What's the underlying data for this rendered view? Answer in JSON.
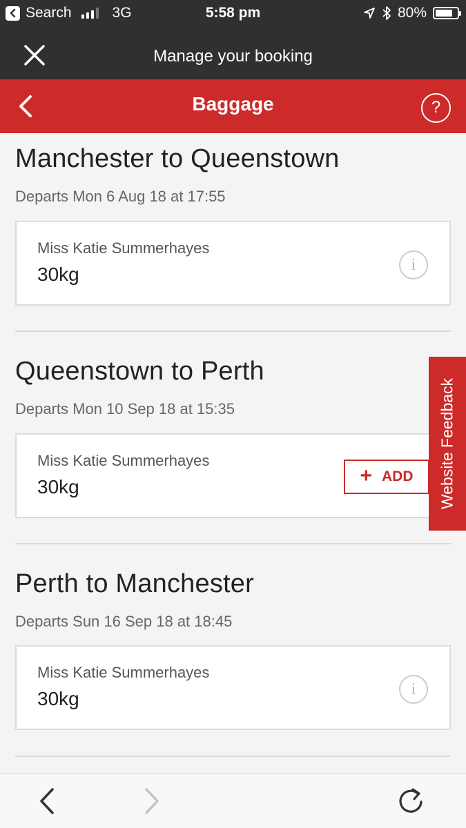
{
  "status_bar": {
    "back_app": "Search",
    "network": "3G",
    "time": "5:58 pm",
    "battery": "80%",
    "battery_level": 0.8
  },
  "header": {
    "title": "Manage your booking"
  },
  "nav": {
    "title": "Baggage",
    "help": "?"
  },
  "routes": [
    {
      "title": "Manchester to Queenstown",
      "departs": "Departs Mon 6 Aug 18 at 17:55",
      "passenger": "Miss Katie Summerhayes",
      "weight": "30kg",
      "action": "info"
    },
    {
      "title": "Queenstown to Perth",
      "departs": "Departs Mon 10 Sep 18 at 15:35",
      "passenger": "Miss Katie Summerhayes",
      "weight": "30kg",
      "action": "add",
      "add_label": "ADD"
    },
    {
      "title": "Perth to Manchester",
      "departs": "Departs Sun 16 Sep 18 at 18:45",
      "passenger": "Miss Katie Summerhayes",
      "weight": "30kg",
      "action": "info"
    }
  ],
  "info_glyph": "i",
  "feedback": {
    "label": "Website Feedback"
  },
  "toolbar": {
    "icons": [
      "back-icon",
      "forward-icon",
      "reload-icon"
    ]
  },
  "colors": {
    "brand_red": "#cd2a2a",
    "dark_bar": "#303030"
  }
}
